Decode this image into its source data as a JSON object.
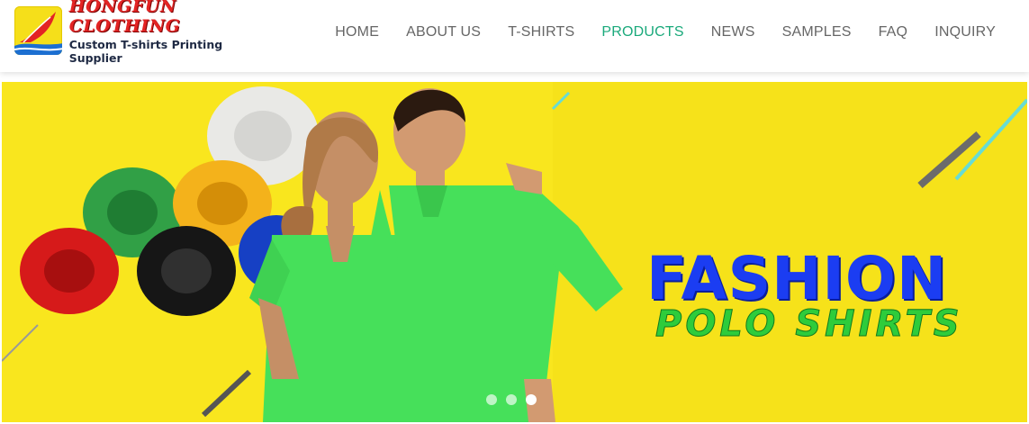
{
  "logo": {
    "title": "HONGFUN CLOTHING",
    "subtitle": "Custom T-shirts Printing Supplier",
    "icon": "feather-logo-icon",
    "colors": {
      "title": "#e32424",
      "badge": "#f5df1a"
    }
  },
  "nav": {
    "items": [
      {
        "label": "HOME"
      },
      {
        "label": "ABOUT US"
      },
      {
        "label": "T-SHIRTS"
      },
      {
        "label": "PRODUCTS"
      },
      {
        "label": "NEWS"
      },
      {
        "label": "SAMPLES"
      },
      {
        "label": "FAQ"
      },
      {
        "label": "INQUIRY"
      }
    ],
    "active_label": "PRODUCTS",
    "active_color": "#1aa97b"
  },
  "banner": {
    "headline": "FASHION",
    "subline": "POLO SHIRTS",
    "background_color": "#f9e61e",
    "headline_color": "#1b3df2",
    "subline_color": "#2ecc3b",
    "slides": {
      "count": 3,
      "active": 3
    }
  }
}
